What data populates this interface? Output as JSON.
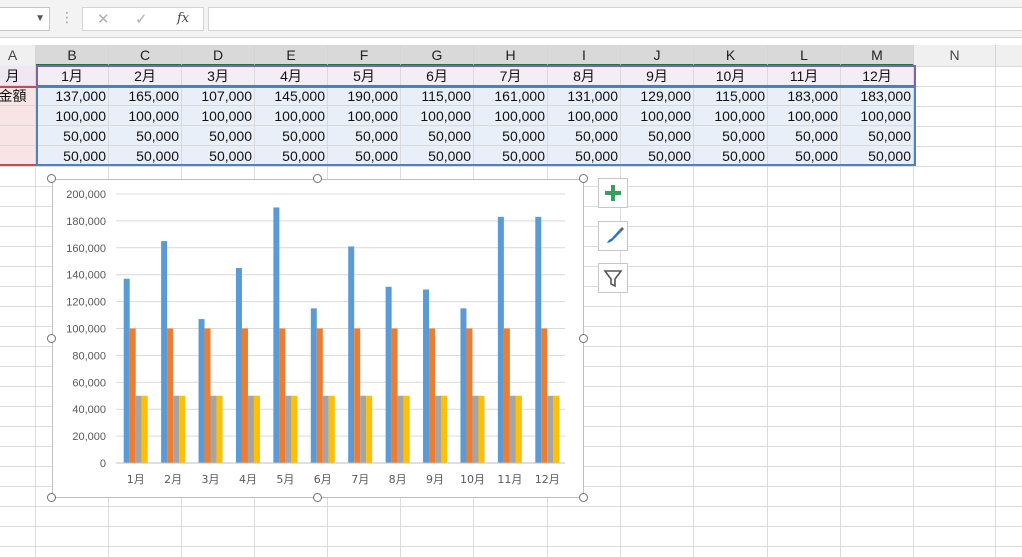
{
  "columns": [
    "A",
    "B",
    "C",
    "D",
    "E",
    "F",
    "G",
    "H",
    "I",
    "J",
    "K",
    "L",
    "M",
    "N"
  ],
  "row_labels": {
    "month_header": "月",
    "amount_label": "金額"
  },
  "months": [
    "1月",
    "2月",
    "3月",
    "4月",
    "5月",
    "6月",
    "7月",
    "8月",
    "9月",
    "10月",
    "11月",
    "12月"
  ],
  "rows": [
    [
      "137,000",
      "165,000",
      "107,000",
      "145,000",
      "190,000",
      "115,000",
      "161,000",
      "131,000",
      "129,000",
      "115,000",
      "183,000",
      "183,000"
    ],
    [
      "100,000",
      "100,000",
      "100,000",
      "100,000",
      "100,000",
      "100,000",
      "100,000",
      "100,000",
      "100,000",
      "100,000",
      "100,000",
      "100,000"
    ],
    [
      "50,000",
      "50,000",
      "50,000",
      "50,000",
      "50,000",
      "50,000",
      "50,000",
      "50,000",
      "50,000",
      "50,000",
      "50,000",
      "50,000"
    ],
    [
      "50,000",
      "50,000",
      "50,000",
      "50,000",
      "50,000",
      "50,000",
      "50,000",
      "50,000",
      "50,000",
      "50,000",
      "50,000",
      "50,000"
    ]
  ],
  "formula_bar": {
    "fx_label": "fx",
    "cancel_label": "✕",
    "enter_label": "✓"
  },
  "colors": {
    "series1": "#5b9bd5",
    "series2": "#ed7d31",
    "series3": "#a5a5a5",
    "series4": "#ffc000"
  },
  "icons": {
    "add_element": "plus-icon",
    "styles": "brush-icon",
    "filter": "funnel-icon"
  },
  "chart_data": {
    "type": "bar",
    "categories": [
      "1月",
      "2月",
      "3月",
      "4月",
      "5月",
      "6月",
      "7月",
      "8月",
      "9月",
      "10月",
      "11月",
      "12月"
    ],
    "series": [
      {
        "values": [
          137000,
          165000,
          107000,
          145000,
          190000,
          115000,
          161000,
          131000,
          129000,
          115000,
          183000,
          183000
        ]
      },
      {
        "values": [
          100000,
          100000,
          100000,
          100000,
          100000,
          100000,
          100000,
          100000,
          100000,
          100000,
          100000,
          100000
        ]
      },
      {
        "values": [
          50000,
          50000,
          50000,
          50000,
          50000,
          50000,
          50000,
          50000,
          50000,
          50000,
          50000,
          50000
        ]
      },
      {
        "values": [
          50000,
          50000,
          50000,
          50000,
          50000,
          50000,
          50000,
          50000,
          50000,
          50000,
          50000,
          50000
        ]
      }
    ],
    "ylim": [
      0,
      200000
    ],
    "yticks": [
      "0",
      "20,000",
      "40,000",
      "60,000",
      "80,000",
      "100,000",
      "120,000",
      "140,000",
      "160,000",
      "180,000",
      "200,000"
    ],
    "grid": true
  }
}
